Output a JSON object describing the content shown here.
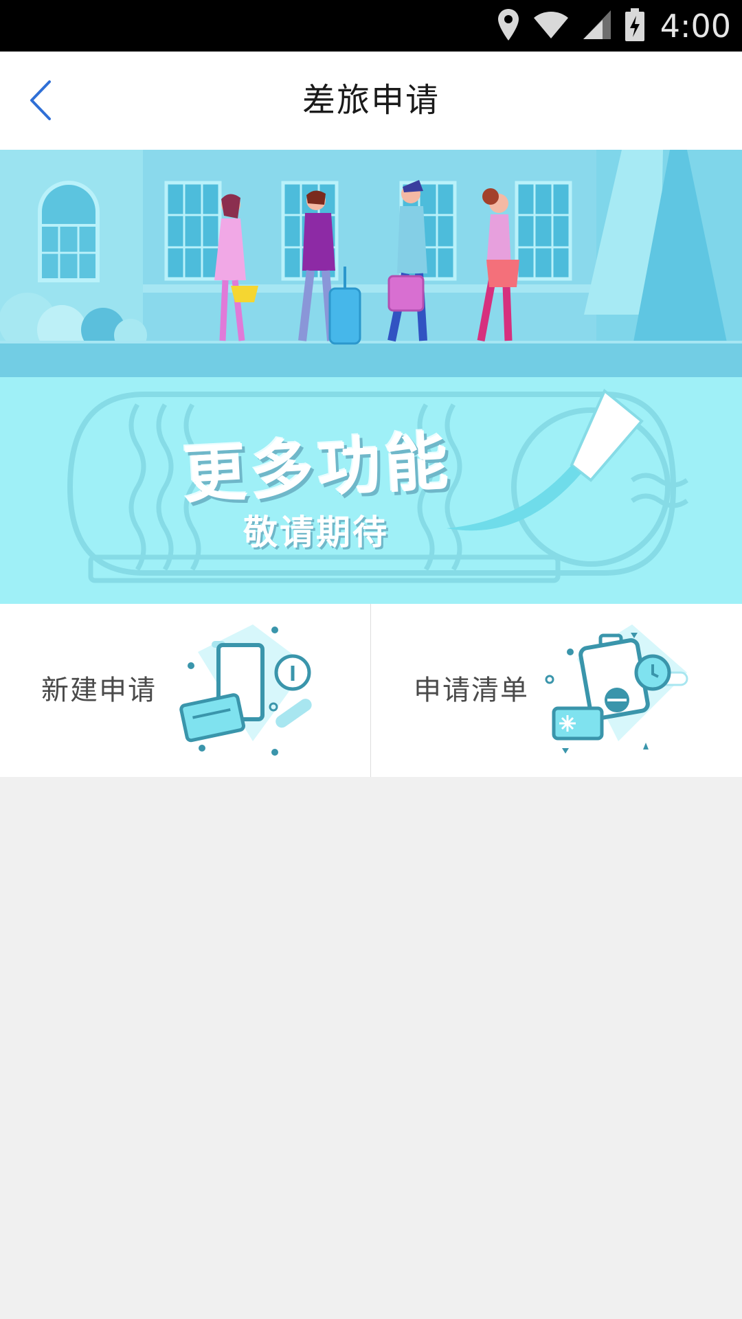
{
  "status_bar": {
    "time": "4:00",
    "icons": [
      "location-icon",
      "wifi-icon",
      "signal-icon",
      "battery-charging-icon"
    ]
  },
  "nav": {
    "title": "差旅申请",
    "back_icon": "chevron-left-icon",
    "accent_color": "#2f6fd6"
  },
  "banner": {
    "headline": "更多功能",
    "subline": "敬请期待"
  },
  "actions": [
    {
      "label": "新建申请",
      "icon": "new-application-illustration"
    },
    {
      "label": "申请清单",
      "icon": "application-list-illustration"
    }
  ],
  "colors": {
    "status_bar": "#000000",
    "nav_bar": "#ffffff",
    "banner_sky": "#7fd6ea",
    "banner_lower": "#9ff0f7",
    "page_background": "#f0f0f0"
  }
}
